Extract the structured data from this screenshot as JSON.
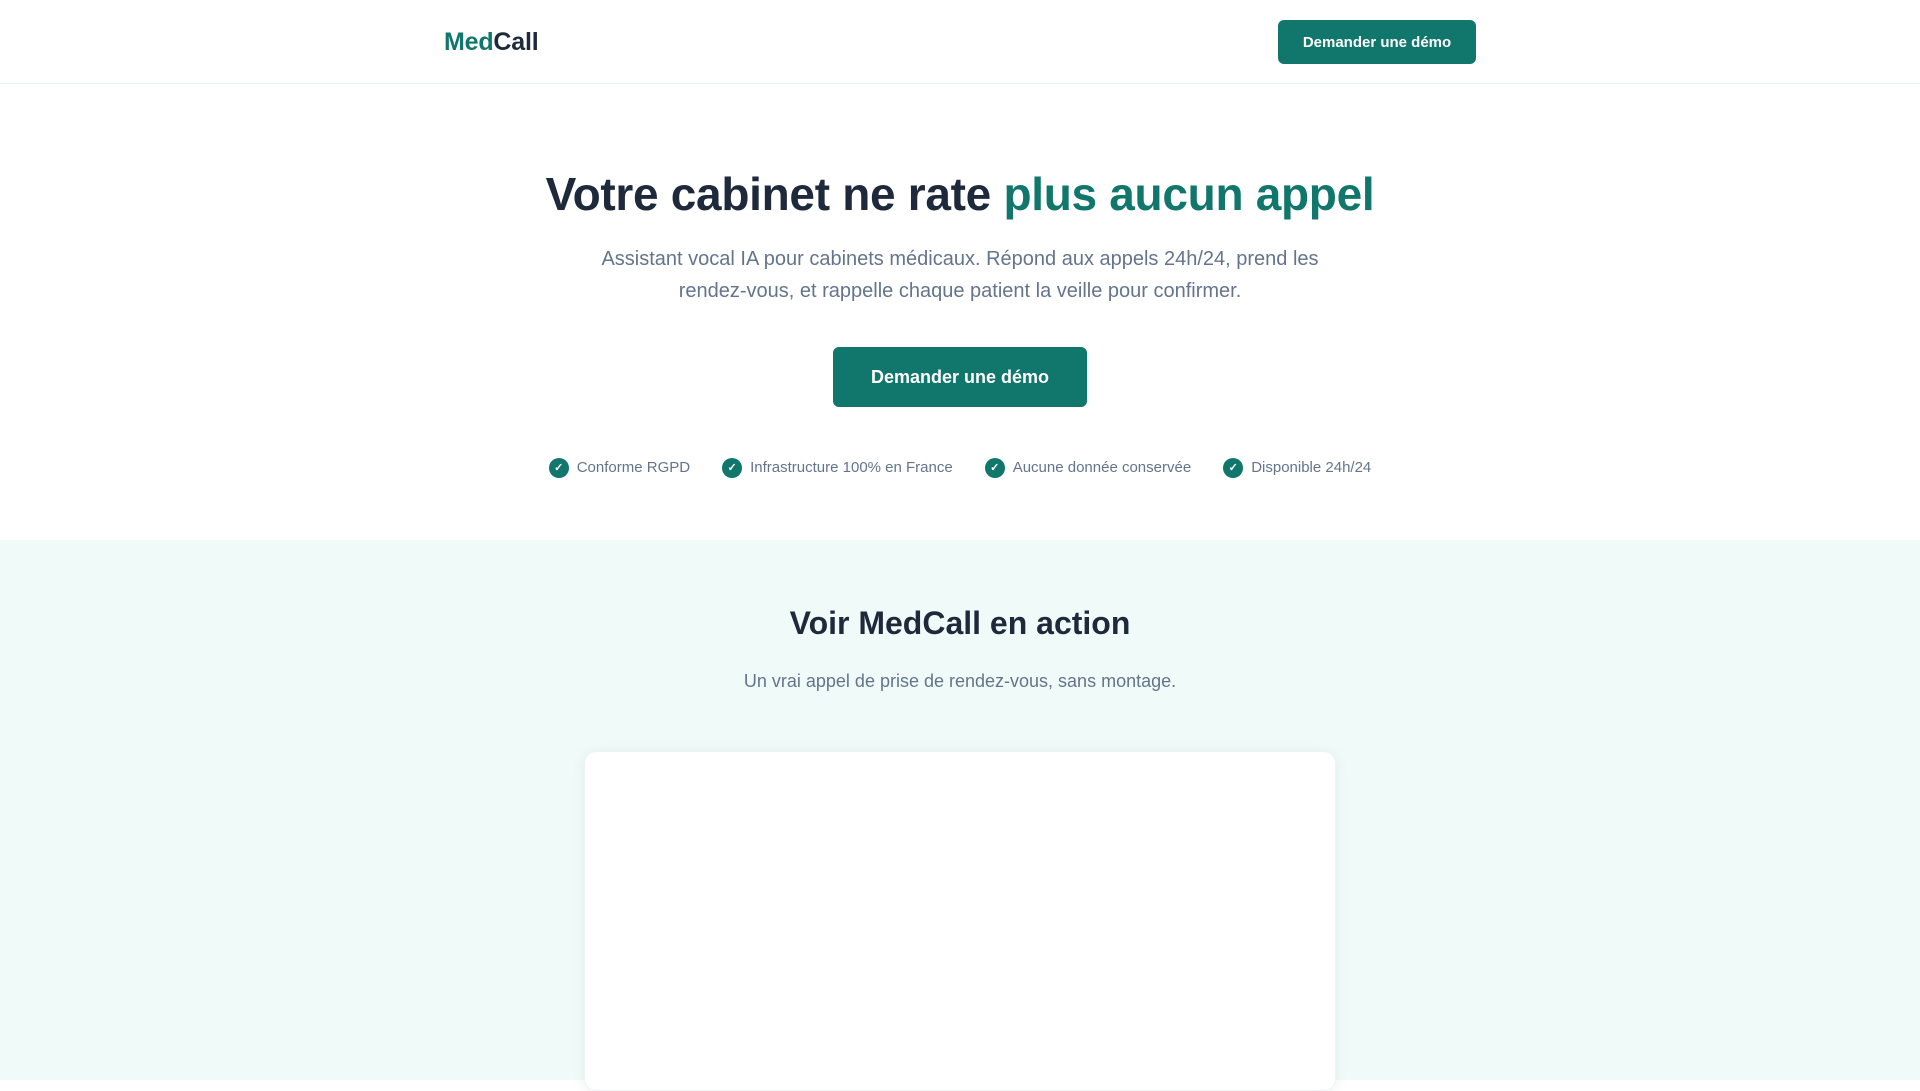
{
  "colors": {
    "brand": "#11766b",
    "text_dark": "#1e293b",
    "text_muted": "#64748b",
    "section_bg": "#f0fbf9"
  },
  "nav": {
    "logo_part1": "Med",
    "logo_part2": "Call",
    "cta_label": "Demander une démo"
  },
  "hero": {
    "title_main": "Votre cabinet ne rate ",
    "title_accent": "plus aucun appel",
    "subtitle": "Assistant vocal IA pour cabinets médicaux. Répond aux appels 24h/24, prend les rendez-vous, et rappelle chaque patient la veille pour confirmer.",
    "cta_label": "Demander une démo",
    "badges": [
      {
        "icon": "check-icon",
        "label": "Conforme RGPD"
      },
      {
        "icon": "check-icon",
        "label": "Infrastructure 100% en France"
      },
      {
        "icon": "check-icon",
        "label": "Aucune donnée conservée"
      },
      {
        "icon": "check-icon",
        "label": "Disponible 24h/24"
      }
    ],
    "check_glyph": "✓"
  },
  "demo": {
    "title": "Voir MedCall en action",
    "subtitle": "Un vrai appel de prise de rendez-vous, sans montage."
  }
}
